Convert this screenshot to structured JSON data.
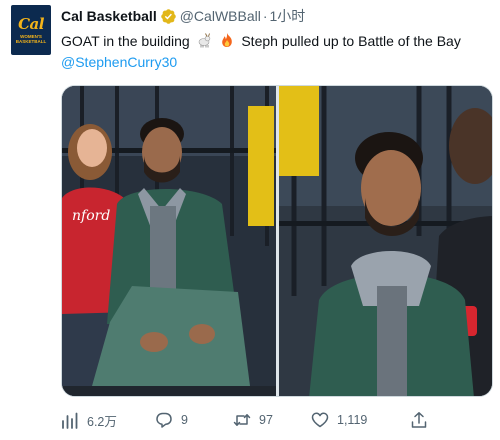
{
  "account": {
    "display_name": "Cal Basketball",
    "handle": "@CalWBBall",
    "separator": "·",
    "time": "1小时",
    "verified_icon": "verified-gold-badge-icon",
    "avatar": {
      "logo_text": "Cal",
      "logo_sub": "WOMEN'S BASKETBALL"
    }
  },
  "tweet": {
    "text_part1": "GOAT in the building",
    "text_part2": "Steph pulled up to Battle of the Bay",
    "emojis": [
      "goat-emoji",
      "fire-emoji"
    ],
    "mention": "@StephenCurry30"
  },
  "media": {
    "photos": [
      {
        "name": "Steph Curry courtside with fan",
        "sweater_text": "nford"
      },
      {
        "name": "Steph Curry smiling courtside"
      }
    ]
  },
  "actions": {
    "views": {
      "icon": "analytics-icon",
      "count": "6.2万"
    },
    "reply": {
      "icon": "reply-icon",
      "count": "9"
    },
    "retweet": {
      "icon": "retweet-icon",
      "count": "97"
    },
    "like": {
      "icon": "heart-icon",
      "count": "1,119"
    },
    "share": {
      "icon": "share-icon"
    }
  },
  "colors": {
    "text": "#0f1419",
    "secondary": "#536471",
    "link": "#1d9bf0",
    "verified_gold": "#e2b719",
    "cal_navy": "#0c2a4f",
    "cal_gold": "#f4b41a"
  }
}
